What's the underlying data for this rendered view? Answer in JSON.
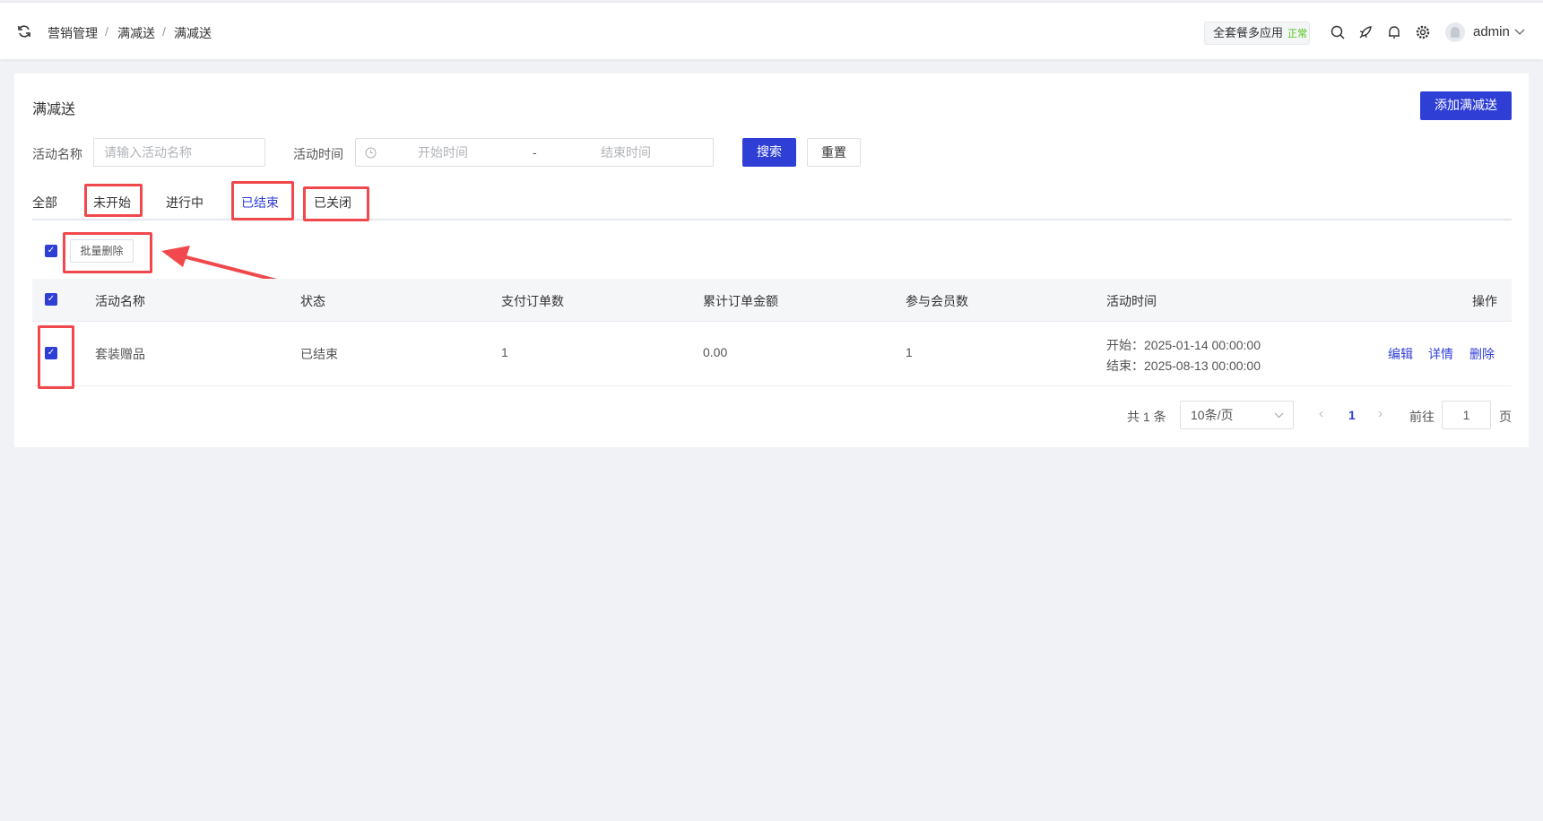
{
  "breadcrumb": [
    "营销管理",
    "满减送",
    "满减送"
  ],
  "header": {
    "badge_label": "全套餐多应用",
    "badge_status": "正常",
    "user": "admin"
  },
  "page": {
    "title": "满减送",
    "add_button": "添加满减送"
  },
  "filters": {
    "name_label": "活动名称",
    "name_placeholder": "请输入活动名称",
    "time_label": "活动时间",
    "start_placeholder": "开始时间",
    "range_sep": "-",
    "end_placeholder": "结束时间",
    "search": "搜索",
    "reset": "重置"
  },
  "tabs": [
    "全部",
    "未开始",
    "进行中",
    "已结束",
    "已关闭"
  ],
  "active_tab": "已结束",
  "batch_delete": "批量删除",
  "table": {
    "headers": [
      "活动名称",
      "状态",
      "支付订单数",
      "累计订单金额",
      "参与会员数",
      "活动时间",
      "操作"
    ],
    "rows": [
      {
        "name": "套装赠品",
        "status": "已结束",
        "orders": "1",
        "amount": "0.00",
        "members": "1",
        "start": "开始：2025-01-14 00:00:00",
        "end": "结束：2025-08-13 00:00:00",
        "actions": [
          "编辑",
          "详情",
          "删除"
        ]
      }
    ]
  },
  "pagination": {
    "total": "共 1 条",
    "page_size": "10条/页",
    "current": "1",
    "goto_label": "前往",
    "goto_value": "1",
    "page_suffix": "页"
  },
  "colors": {
    "primary": "#2f3fd6",
    "annotation": "#f0484c"
  }
}
